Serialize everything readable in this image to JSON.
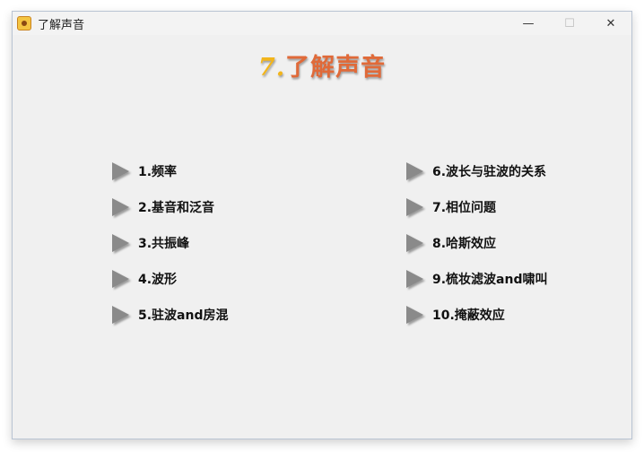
{
  "window": {
    "title": "了解声音",
    "controls": {
      "minimize": "—",
      "maximize": "☐",
      "close": "✕"
    }
  },
  "heading": {
    "number": "7.",
    "text": "了解声音"
  },
  "menu": {
    "left": [
      {
        "label": "1.频率"
      },
      {
        "label": "2.基音和泛音"
      },
      {
        "label": "3.共振峰"
      },
      {
        "label": "4.波形"
      },
      {
        "label": "5.驻波and房混"
      }
    ],
    "right": [
      {
        "label": "6.波长与驻波的关系"
      },
      {
        "label": "7.相位问题"
      },
      {
        "label": "8.哈斯效应"
      },
      {
        "label": "9.梳妆滤波and啸叫"
      },
      {
        "label": "10.掩蔽效应"
      }
    ]
  },
  "icons": {
    "app": "app-icon",
    "item": "play-arrow-icon"
  }
}
